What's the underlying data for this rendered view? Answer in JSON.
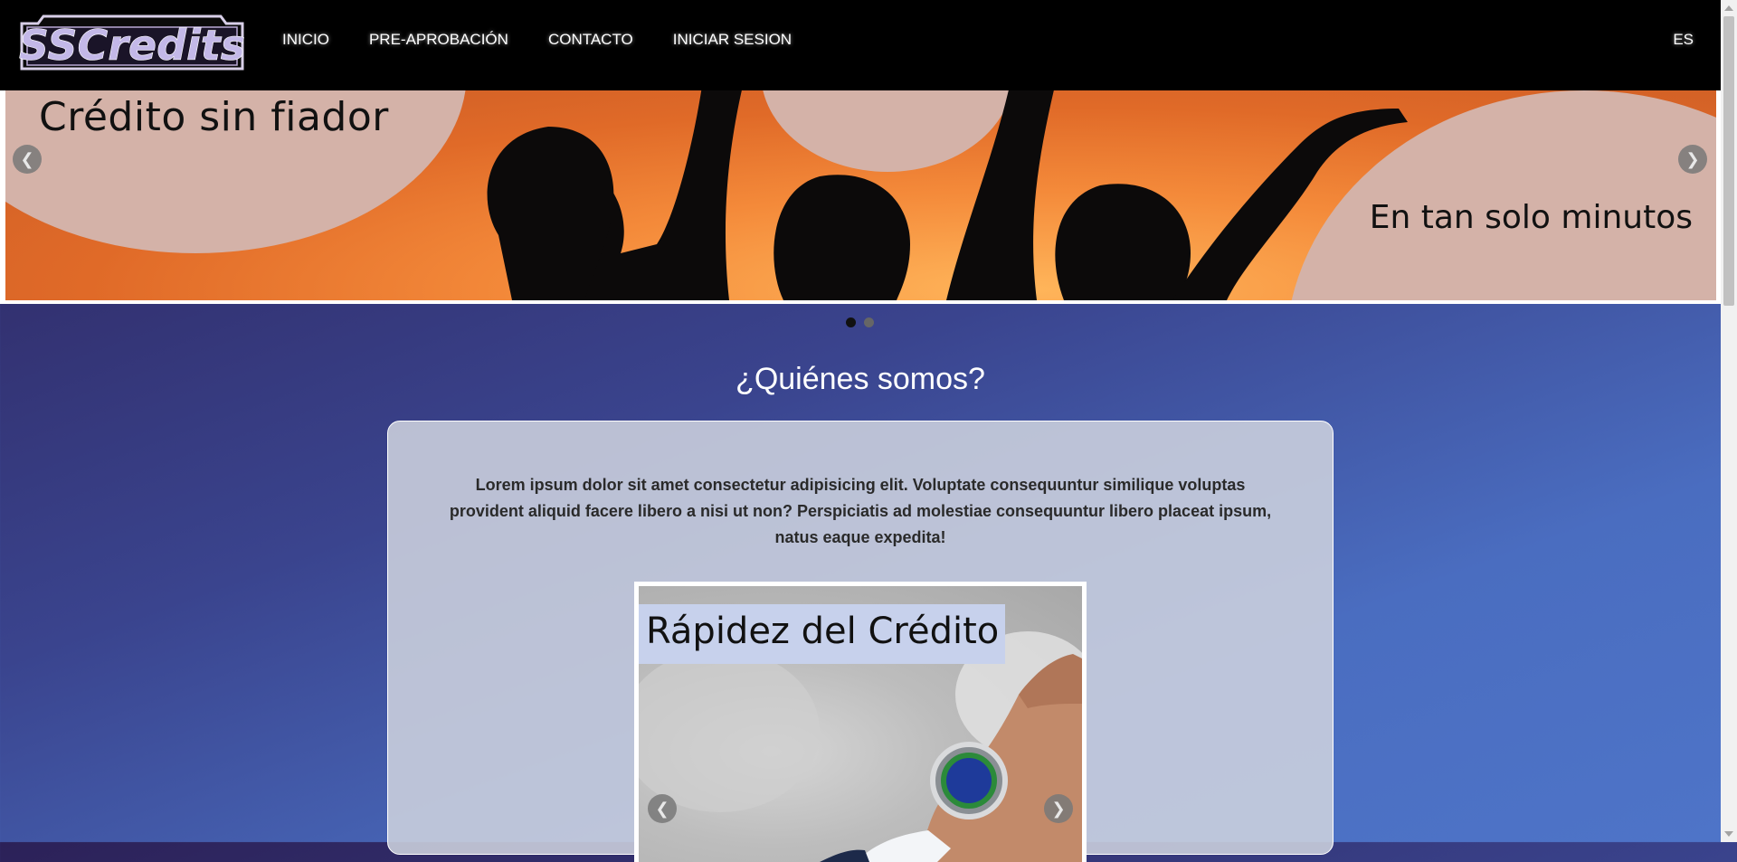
{
  "brand": {
    "logo_text": "SSCredits"
  },
  "nav": {
    "items": [
      {
        "label": "INICIO"
      },
      {
        "label": "PRE-APROBACIÓN"
      },
      {
        "label": "CONTACTO"
      },
      {
        "label": "INICIAR SESION"
      }
    ],
    "language": "ES"
  },
  "hero": {
    "slide_text_left": "Crédito sin fiador",
    "slide_text_right": "En tan solo minutos",
    "prev_icon": "chevron-left-icon",
    "next_icon": "chevron-right-icon",
    "slide_count": 2,
    "active_slide": 1
  },
  "about": {
    "title": "¿Quiénes somos?",
    "text": "Lorem ipsum dolor sit amet consectetur adipisicing elit. Voluptate consequuntur similique voluptas provident aliquid facere libero a nisi ut non? Perspiciatis ad molestiae consequuntur libero placeat ipsum, natus eaque expedita!",
    "slide_title": "Rápidez del Crédito"
  },
  "colors": {
    "navbar": "#000000",
    "hero_orange": "#f48a3a",
    "hero_circle": "#d4b2a8",
    "banner": "#c7d1ec"
  }
}
